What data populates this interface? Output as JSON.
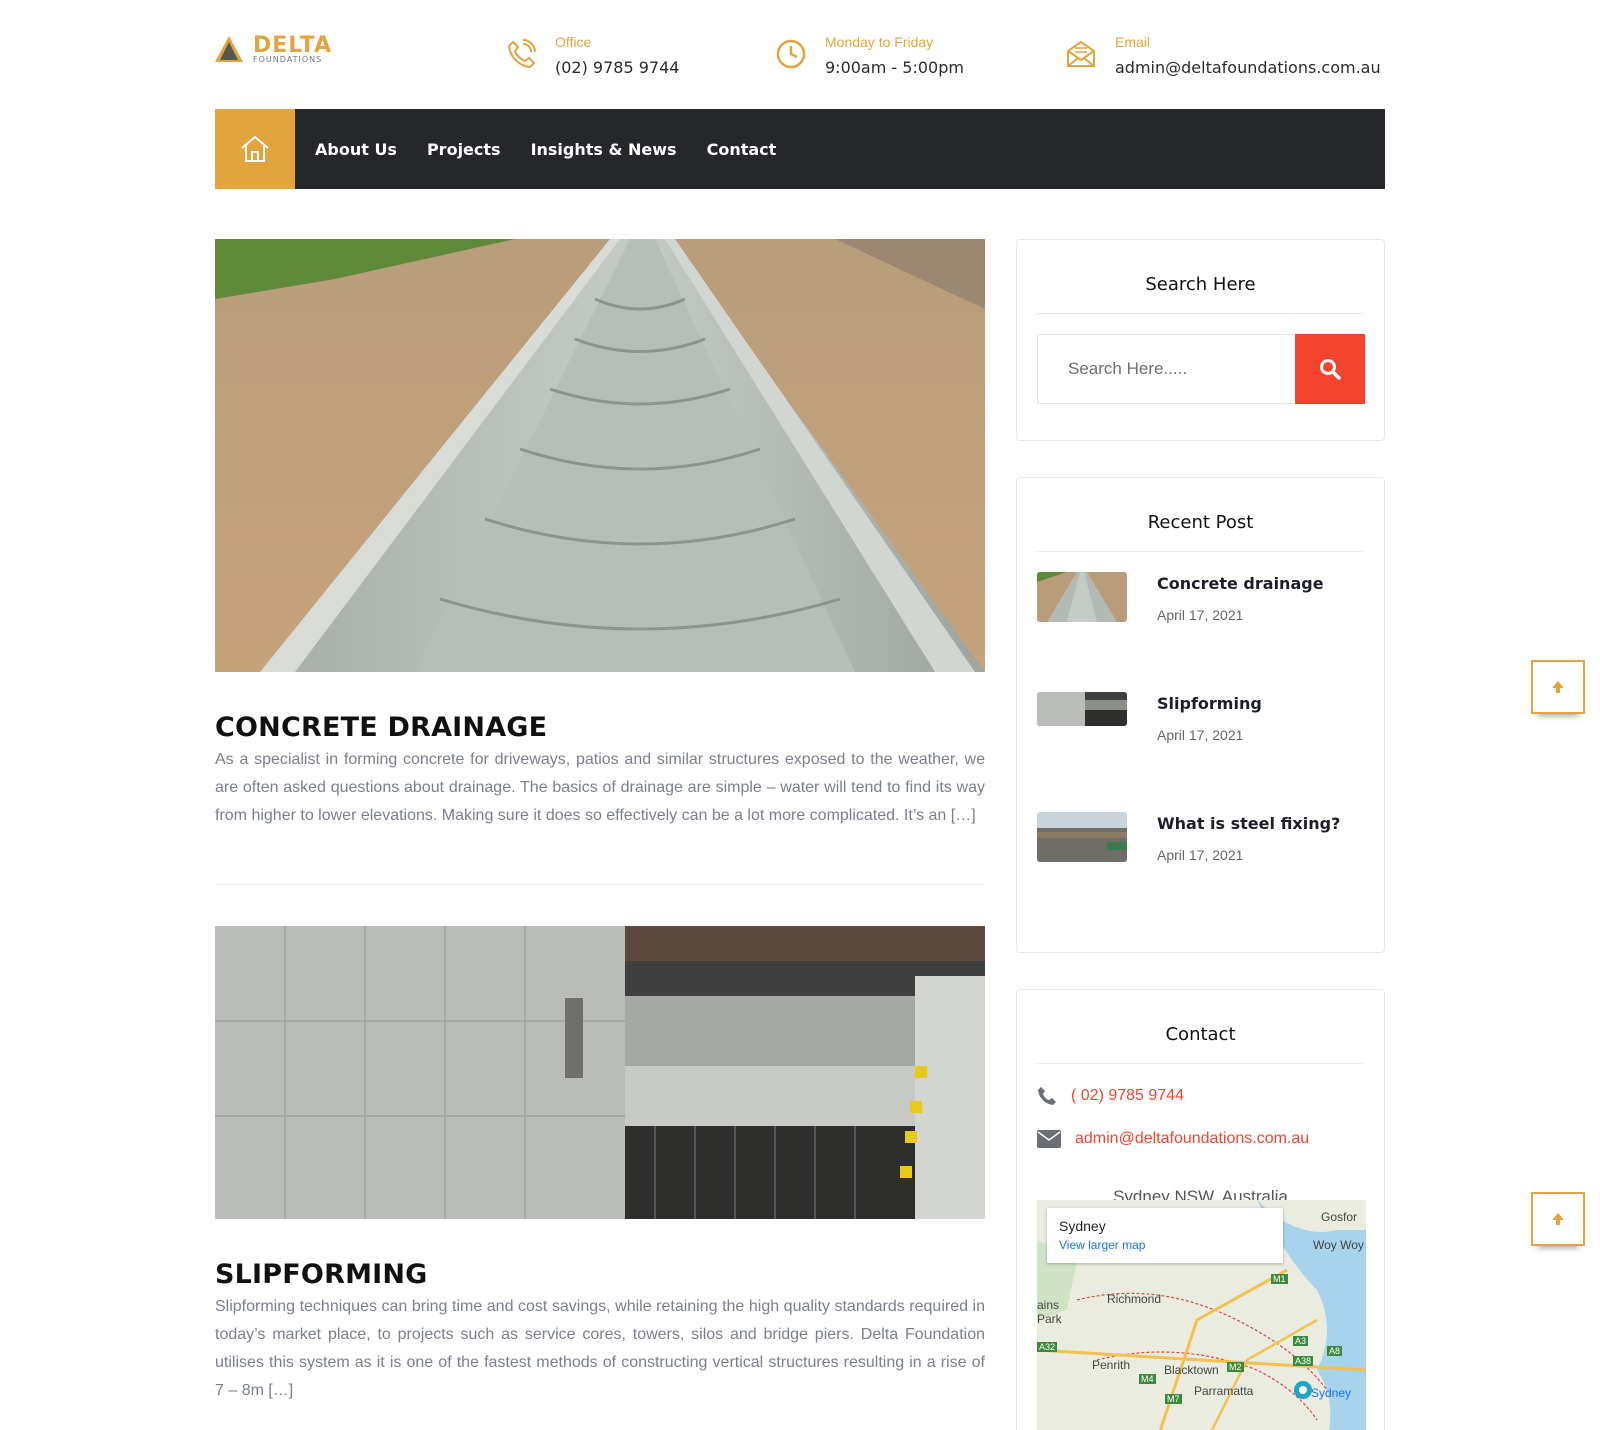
{
  "header": {
    "logo_text": "DELTA",
    "logo_sub": "FOUNDATIONS",
    "office_label": "Office",
    "office_value": "(02) 9785 9744",
    "hours_label": "Monday to Friday",
    "hours_value": "9:00am - 5:00pm",
    "email_label": "Email",
    "email_value": "admin@deltafoundations.com.au"
  },
  "nav": {
    "home_icon": "home-icon",
    "links": [
      "About Us",
      "Projects",
      "Insights & News",
      "Contact"
    ]
  },
  "posts": [
    {
      "title": "CONCRETE DRAINAGE",
      "excerpt": "As a specialist in forming concrete for driveways, patios and similar structures exposed to the weather, we are often asked questions about drainage. The basics of drainage are simple – water will tend to find its way from higher to lower elevations. Making sure it does so effectively can be a lot more complicated. It’s an […]"
    },
    {
      "title": "SLIPFORMING",
      "excerpt": "Slipforming techniques can bring time and cost savings, while retaining the high quality standards required in today’s market place, to projects such as service cores, towers, silos and bridge piers. Delta Foundation utilises this system as it is one of the fastest methods of constructing vertical structures resulting in a rise of 7 – 8m […]"
    }
  ],
  "sidebar": {
    "search_title": "Search Here",
    "search_placeholder": "Search Here.....",
    "recent_title": "Recent Post",
    "recent_posts": [
      {
        "title": "Concrete drainage",
        "date": "April 17, 2021"
      },
      {
        "title": "Slipforming",
        "date": "April 17, 2021"
      },
      {
        "title": "What is steel fixing?",
        "date": "April 17, 2021"
      }
    ],
    "contact_title": "Contact",
    "contact_phone": "( 02) 9785 9744",
    "contact_email": "admin@deltafoundations.com.au",
    "location": "Sydney NSW, Australia",
    "map": {
      "place": "Sydney",
      "link": "View larger map",
      "labels": [
        "Richmond",
        "Penrith",
        "Blacktown",
        "Parramatta",
        "Sydney",
        "Gosfor",
        "Woy Woy",
        "ains Park",
        "M1",
        "M2",
        "M4",
        "M7",
        "A3",
        "A8",
        "A38",
        "A32"
      ]
    }
  },
  "colors": {
    "accent": "#e3a43d",
    "nav_bg": "#25272b",
    "search_btn": "#f4442e"
  }
}
